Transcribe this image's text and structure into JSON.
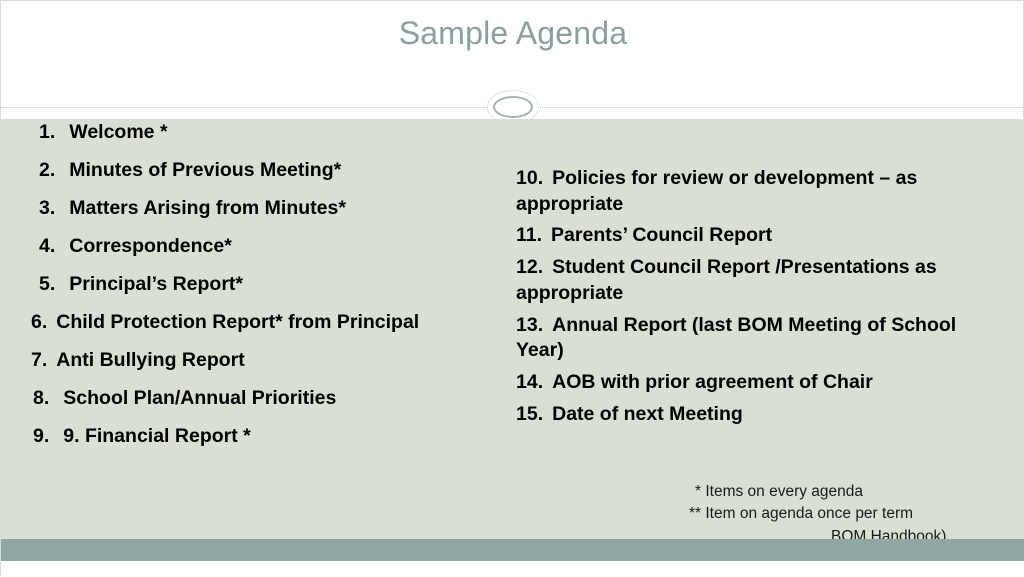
{
  "slide": {
    "title": "Sample Agenda",
    "left_items": [
      {
        "num": "1.",
        "text": "Welcome *"
      },
      {
        "num": "2.",
        "text": "Minutes of Previous Meeting*"
      },
      {
        "num": "3.",
        "text": "Matters Arising from Minutes*"
      },
      {
        "num": "4.",
        "text": "Correspondence*"
      },
      {
        "num": "5.",
        "text": "Principal’s Report*"
      },
      {
        "num": "6.",
        "text": "Child Protection Report* from Principal"
      },
      {
        "num": "7.",
        "text": "Anti Bullying Report"
      },
      {
        "num": "8.",
        "text": "School Plan/Annual Priorities"
      },
      {
        "num": "9.",
        "text": "9.  Financial Report *"
      }
    ],
    "right_items": [
      {
        "num": "10.",
        "text": "Policies for review or development – as appropriate"
      },
      {
        "num": "11.",
        "text": "Parents’ Council Report"
      },
      {
        "num": "12.",
        "text": "Student Council Report /Presentations as appropriate"
      },
      {
        "num": "13.",
        "text": "Annual Report (last BOM Meeting of School Year)"
      },
      {
        "num": "14.",
        "text": "AOB with prior agreement of Chair"
      },
      {
        "num": "15.",
        "text": "Date of next Meeting"
      }
    ],
    "notes": [
      "*  Items on every agenda",
      "** Item on agenda once per term",
      "BOM Handbook)"
    ],
    "colors": {
      "title": "#8aa0a0",
      "body_panel": "#d7e0d3",
      "footer_bar": "#8fa6a4",
      "text": "#000000"
    }
  }
}
